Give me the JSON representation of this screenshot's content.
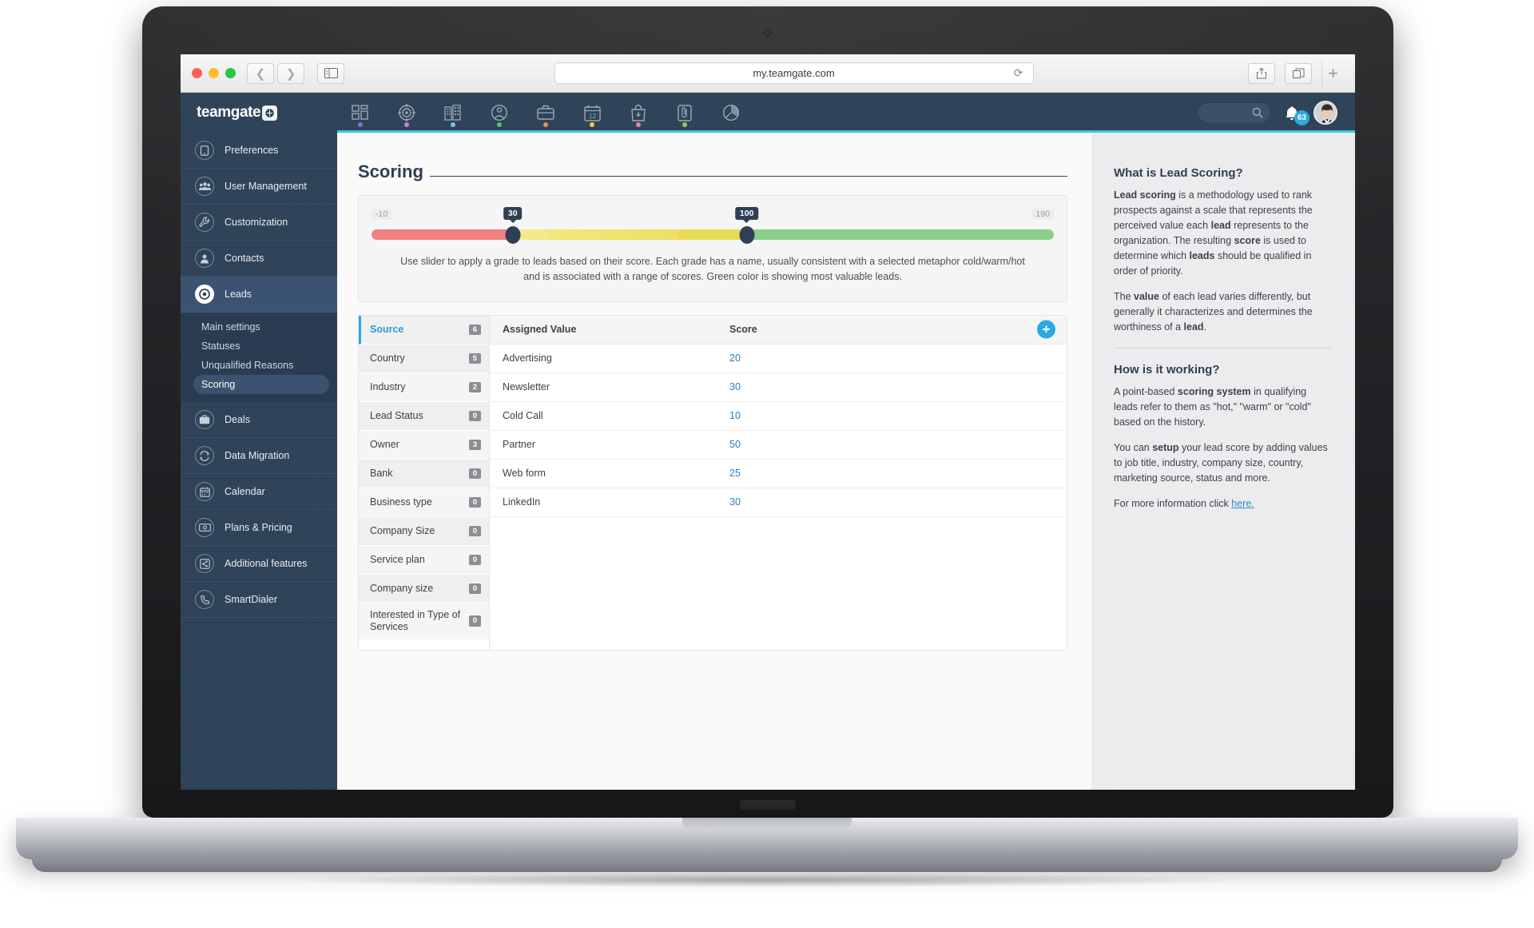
{
  "browser": {
    "url": "my.teamgate.com",
    "reload_icon": "reload-icon",
    "back_icon": "chevron-left-icon",
    "forward_icon": "chevron-right-icon",
    "sidebar_icon": "sidebar-toggle-icon",
    "share_icon": "share-icon",
    "tabs_icon": "tabs-overview-icon",
    "new_tab_label": "+"
  },
  "topnav": {
    "brand": "teamgate",
    "items": [
      {
        "name": "dashboard-icon",
        "dot": "#7b6fe0"
      },
      {
        "name": "leads-target-icon",
        "dot": "#d17ce0"
      },
      {
        "name": "companies-icon",
        "dot": "#72c2e8"
      },
      {
        "name": "contacts-icon",
        "dot": "#53c66a"
      },
      {
        "name": "deals-briefcase-icon",
        "dot": "#ef9340"
      },
      {
        "name": "calendar-icon",
        "dot": "#efd03d",
        "label": "12"
      },
      {
        "name": "shopping-bag-icon",
        "dot": "#e887a8"
      },
      {
        "name": "documents-icon",
        "dot": "#8fce4b"
      },
      {
        "name": "reports-pie-icon",
        "dot": ""
      }
    ],
    "search_placeholder": "",
    "notifications_count": "63",
    "accent_color": "#38c6e0"
  },
  "sidebar": {
    "items": [
      {
        "label": "Preferences",
        "icon": "preferences-icon",
        "active": false
      },
      {
        "label": "User Management",
        "icon": "users-icon",
        "active": false
      },
      {
        "label": "Customization",
        "icon": "wrench-icon",
        "active": false
      },
      {
        "label": "Contacts",
        "icon": "contact-person-icon",
        "active": false
      },
      {
        "label": "Leads",
        "icon": "leads-target-icon",
        "active": true
      },
      {
        "label": "Deals",
        "icon": "briefcase-icon",
        "active": false
      },
      {
        "label": "Data Migration",
        "icon": "data-migration-icon",
        "active": false
      },
      {
        "label": "Calendar",
        "icon": "calendar-icon",
        "active": false
      },
      {
        "label": "Plans & Pricing",
        "icon": "money-icon",
        "active": false
      },
      {
        "label": "Additional features",
        "icon": "puzzle-icon",
        "active": false
      },
      {
        "label": "SmartDialer",
        "icon": "phone-icon",
        "active": false
      }
    ],
    "subitems": [
      {
        "label": "Main settings",
        "active": false
      },
      {
        "label": "Statuses",
        "active": false
      },
      {
        "label": "Unqualified Reasons",
        "active": false
      },
      {
        "label": "Scoring",
        "active": true
      }
    ]
  },
  "main": {
    "title": "Scoring",
    "slider": {
      "min_label": "-10",
      "max_label": "190",
      "handle1": "30",
      "handle2": "100",
      "min": -10,
      "max": 190,
      "colors": {
        "cold": "#f08080",
        "warm": "#e8db56",
        "hot": "#8cce8c"
      }
    },
    "description": "Use slider to apply a grade to leads based on their score. Each grade has a name, usually consistent with a selected metaphor cold/warm/hot and is associated with a range of scores. Green color is showing most valuable leads.",
    "fields": [
      {
        "label": "Source",
        "count": "6",
        "active": true
      },
      {
        "label": "Country",
        "count": "5",
        "active": false
      },
      {
        "label": "Industry",
        "count": "2",
        "active": false
      },
      {
        "label": "Lead Status",
        "count": "0",
        "active": false
      },
      {
        "label": "Owner",
        "count": "3",
        "active": false
      },
      {
        "label": "Bank",
        "count": "0",
        "active": false
      },
      {
        "label": "Business type",
        "count": "0",
        "active": false
      },
      {
        "label": "Company Size",
        "count": "0",
        "active": false
      },
      {
        "label": "Service plan",
        "count": "0",
        "active": false
      },
      {
        "label": "Company size",
        "count": "0",
        "active": false
      },
      {
        "label": "Interested in Type of Services",
        "count": "0",
        "active": false,
        "tall": true
      }
    ],
    "table": {
      "col_value": "Assigned Value",
      "col_score": "Score",
      "add_label": "+",
      "rows": [
        {
          "value": "Advertising",
          "score": "20"
        },
        {
          "value": "Newsletter",
          "score": "30"
        },
        {
          "value": "Cold Call",
          "score": "10"
        },
        {
          "value": "Partner",
          "score": "50"
        },
        {
          "value": "Web form",
          "score": "25"
        },
        {
          "value": "LinkedIn",
          "score": "30"
        }
      ]
    }
  },
  "rightpanel": {
    "h1": "What is Lead Scoring?",
    "p1_a": "Lead scoring",
    "p1_b": " is a methodology used to rank prospects against a scale that represents the perceived value each ",
    "p1_c": "lead",
    "p1_d": " represents to the organization. The resulting ",
    "p1_e": "score",
    "p1_f": " is used to determine which ",
    "p1_g": "leads",
    "p1_h": " should be qualified in order of priority.",
    "p2_a": "The ",
    "p2_b": "value",
    "p2_c": " of each lead varies differently, but generally it characterizes and determines the worthiness of a ",
    "p2_d": "lead",
    "p2_e": ".",
    "h2": "How is it working?",
    "p3_a": "A point-based ",
    "p3_b": "scoring system",
    "p3_c": " in qualifying leads refer to them as \"hot,\" \"warm\" or \"cold\" based on the history.",
    "p4_a": "You can ",
    "p4_b": "setup",
    "p4_c": " your lead score by adding values to job title, industry, company size, country, marketing source, status and more.",
    "p5_a": "For more information click ",
    "p5_link": "here."
  }
}
